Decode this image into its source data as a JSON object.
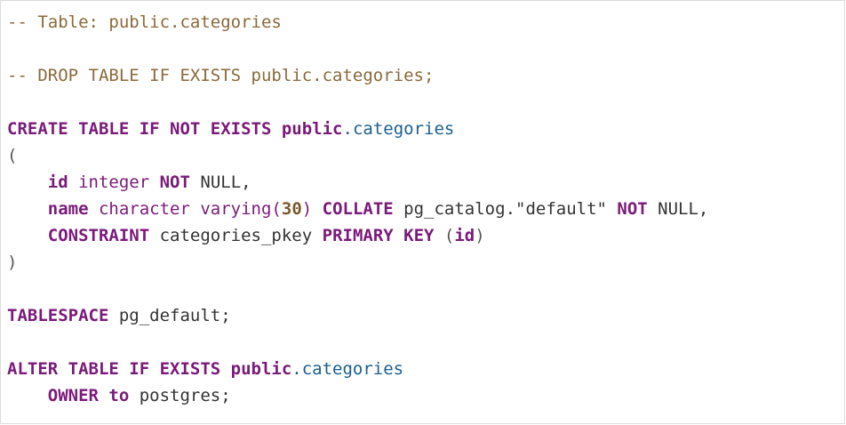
{
  "editor": {
    "lines": [
      [
        {
          "t": "-- Table: public.categories",
          "c": "comment"
        }
      ],
      [],
      [
        {
          "t": "-- DROP TABLE IF EXISTS public.categories;",
          "c": "comment"
        }
      ],
      [],
      [
        {
          "t": "CREATE TABLE IF NOT EXISTS public",
          "c": "keyword"
        },
        {
          "t": ".categories",
          "c": "property"
        }
      ],
      [
        {
          "t": "(",
          "c": "punct"
        }
      ],
      [
        {
          "t": "    ",
          "c": "plain"
        },
        {
          "t": "id",
          "c": "keyword"
        },
        {
          "t": " integer ",
          "c": "type"
        },
        {
          "t": "NOT",
          "c": "keyword"
        },
        {
          "t": " NULL,",
          "c": "plain"
        }
      ],
      [
        {
          "t": "    ",
          "c": "plain"
        },
        {
          "t": "name",
          "c": "keyword"
        },
        {
          "t": " character varying(",
          "c": "type"
        },
        {
          "t": "30",
          "c": "number"
        },
        {
          "t": ") ",
          "c": "type"
        },
        {
          "t": "COLLATE",
          "c": "keyword"
        },
        {
          "t": " pg_catalog.\"default\" ",
          "c": "plain"
        },
        {
          "t": "NOT",
          "c": "keyword"
        },
        {
          "t": " NULL,",
          "c": "plain"
        }
      ],
      [
        {
          "t": "    ",
          "c": "plain"
        },
        {
          "t": "CONSTRAINT",
          "c": "keyword"
        },
        {
          "t": " categories_pkey ",
          "c": "plain"
        },
        {
          "t": "PRIMARY KEY",
          "c": "keyword"
        },
        {
          "t": " (",
          "c": "punct"
        },
        {
          "t": "id",
          "c": "keyword"
        },
        {
          "t": ")",
          "c": "punct"
        }
      ],
      [
        {
          "t": ")",
          "c": "punct"
        }
      ],
      [],
      [
        {
          "t": "TABLESPACE",
          "c": "keyword"
        },
        {
          "t": " pg_default;",
          "c": "plain"
        }
      ],
      [],
      [
        {
          "t": "ALTER TABLE IF EXISTS public",
          "c": "keyword"
        },
        {
          "t": ".categories",
          "c": "property"
        }
      ],
      [
        {
          "t": "    ",
          "c": "plain"
        },
        {
          "t": "OWNER to",
          "c": "keyword"
        },
        {
          "t": " postgres;",
          "c": "plain"
        }
      ]
    ]
  }
}
